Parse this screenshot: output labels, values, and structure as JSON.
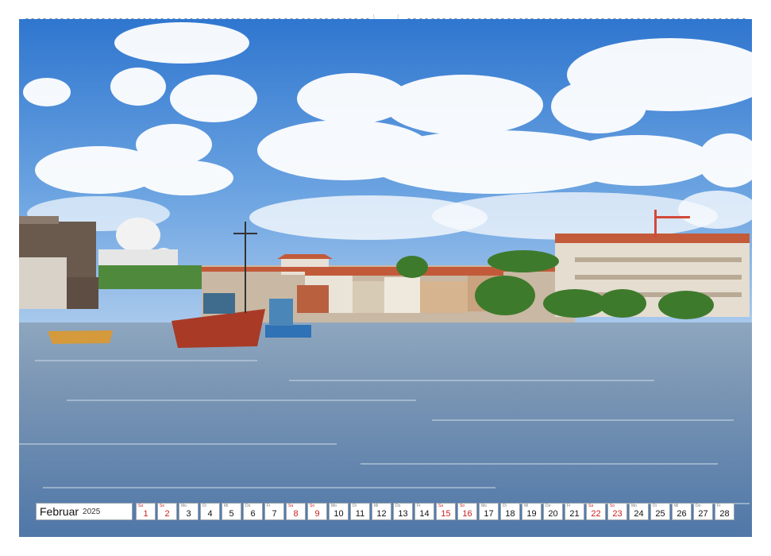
{
  "calendar": {
    "month": "Februar",
    "year": "2025",
    "weekend_color": "#cc1f1f",
    "days": [
      {
        "wd": "Sa",
        "num": "1",
        "we": true
      },
      {
        "wd": "So",
        "num": "2",
        "we": true
      },
      {
        "wd": "Mo",
        "num": "3",
        "we": false
      },
      {
        "wd": "Di",
        "num": "4",
        "we": false
      },
      {
        "wd": "Mi",
        "num": "5",
        "we": false
      },
      {
        "wd": "Do",
        "num": "6",
        "we": false
      },
      {
        "wd": "Fr",
        "num": "7",
        "we": false
      },
      {
        "wd": "Sa",
        "num": "8",
        "we": true
      },
      {
        "wd": "So",
        "num": "9",
        "we": true
      },
      {
        "wd": "Mo",
        "num": "10",
        "we": false
      },
      {
        "wd": "Di",
        "num": "11",
        "we": false
      },
      {
        "wd": "Mi",
        "num": "12",
        "we": false
      },
      {
        "wd": "Do",
        "num": "13",
        "we": false
      },
      {
        "wd": "Fr",
        "num": "14",
        "we": false
      },
      {
        "wd": "Sa",
        "num": "15",
        "we": true
      },
      {
        "wd": "So",
        "num": "16",
        "we": true
      },
      {
        "wd": "Mo",
        "num": "17",
        "we": false
      },
      {
        "wd": "Di",
        "num": "18",
        "we": false
      },
      {
        "wd": "Mi",
        "num": "19",
        "we": false
      },
      {
        "wd": "Do",
        "num": "20",
        "we": false
      },
      {
        "wd": "Fr",
        "num": "21",
        "we": false
      },
      {
        "wd": "Sa",
        "num": "22",
        "we": true
      },
      {
        "wd": "So",
        "num": "23",
        "we": true
      },
      {
        "wd": "Mo",
        "num": "24",
        "we": false
      },
      {
        "wd": "Di",
        "num": "25",
        "we": false
      },
      {
        "wd": "Mi",
        "num": "26",
        "we": false
      },
      {
        "wd": "Do",
        "num": "27",
        "we": false
      },
      {
        "wd": "Fr",
        "num": "28",
        "we": false
      }
    ]
  }
}
